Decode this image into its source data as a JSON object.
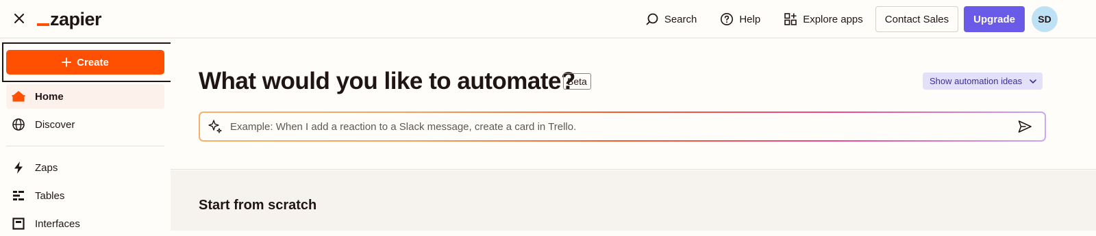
{
  "header": {
    "logo_text": "zapier",
    "search_label": "Search",
    "help_label": "Help",
    "explore_label": "Explore apps",
    "contact_label": "Contact Sales",
    "upgrade_label": "Upgrade",
    "avatar_initials": "SD"
  },
  "sidebar": {
    "create_label": "Create",
    "items": [
      {
        "label": "Home",
        "icon": "home-icon",
        "active": true
      },
      {
        "label": "Discover",
        "icon": "globe-icon"
      },
      {
        "label": "Zaps",
        "icon": "bolt-icon"
      },
      {
        "label": "Tables",
        "icon": "tables-icon"
      },
      {
        "label": "Interfaces",
        "icon": "interfaces-icon"
      }
    ]
  },
  "main": {
    "title": "What would you like to automate?",
    "beta_badge": "Beta",
    "ideas_label": "Show automation ideas",
    "prompt_placeholder": "Example: When I add a reaction to a Slack message, create a card in Trello.",
    "section_title": "Start from scratch"
  },
  "colors": {
    "brand_orange": "#ff4f00",
    "upgrade_purple": "#695be8",
    "avatar_blue": "#bfe1f5",
    "ideas_bg": "#e3e0fa"
  }
}
